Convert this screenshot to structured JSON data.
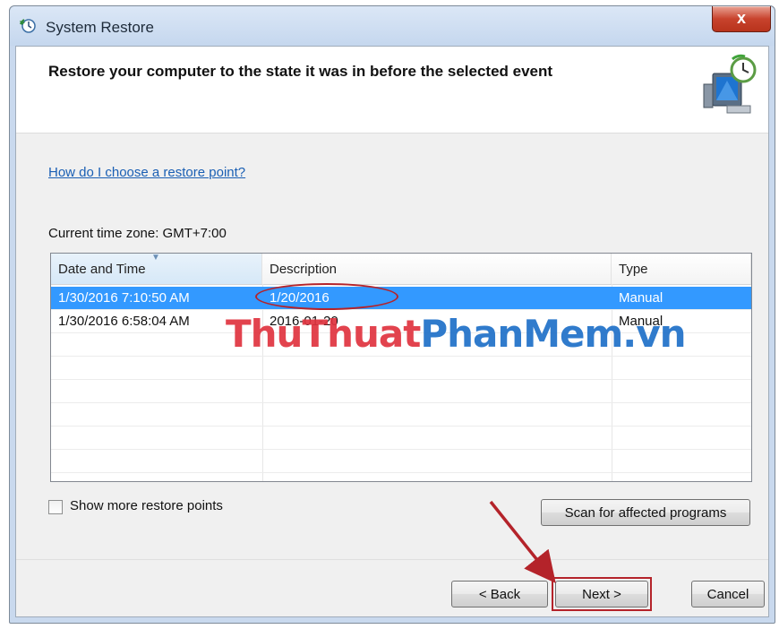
{
  "window": {
    "title": "System Restore",
    "close_label": "x"
  },
  "header": {
    "title": "Restore your computer to the state it was in before the selected event"
  },
  "help_link": "How do I choose a restore point?",
  "timezone_label": "Current time zone: GMT+7:00",
  "table": {
    "columns": [
      "Date and Time",
      "Description",
      "Type"
    ],
    "rows": [
      {
        "date": "1/30/2016 7:10:50 AM",
        "description": "1/20/2016",
        "type": "Manual",
        "selected": true
      },
      {
        "date": "1/30/2016 6:58:04 AM",
        "description": "2016-01-20",
        "type": "Manual",
        "selected": false
      }
    ]
  },
  "show_more_label": "Show more restore points",
  "show_more_checked": false,
  "scan_button": "Scan for affected programs",
  "buttons": {
    "back": "< Back",
    "next": "Next >",
    "cancel": "Cancel"
  },
  "watermark": {
    "part1": "ThuThuat",
    "part2": "PhanMem.vn"
  },
  "colors": {
    "selection": "#3399ff",
    "annotation": "#b4232a",
    "link": "#1a5fb4"
  }
}
